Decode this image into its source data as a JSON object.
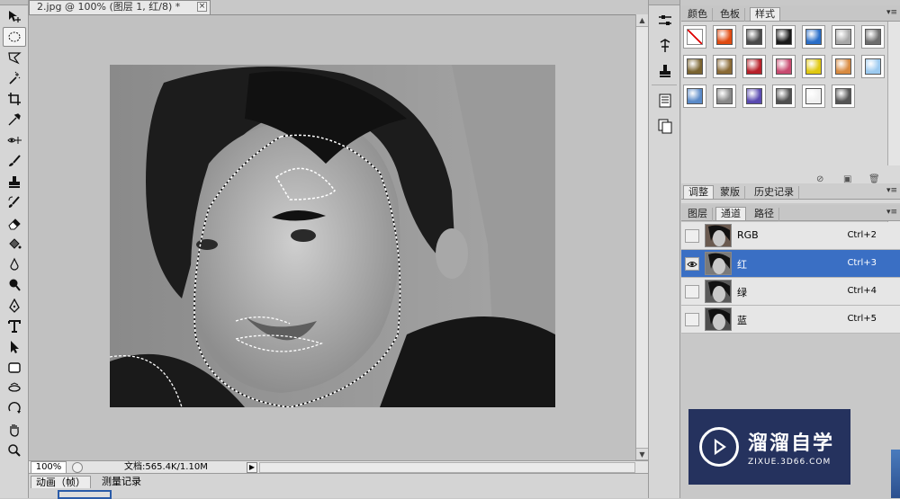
{
  "document": {
    "tab_title": "2.jpg @ 100% (图层 1, 红/8) *",
    "close_glyph": "×"
  },
  "status": {
    "zoom": "100%",
    "doc_size": "文档:565.4K/1.10M",
    "play_glyph": "▶"
  },
  "bottom_panel": {
    "tabs": [
      "动画（帧）",
      "测量记录"
    ]
  },
  "styles_panel": {
    "tabs": [
      "颜色",
      "色板",
      "样式"
    ],
    "active_tab": "样式",
    "swatches": [
      {
        "name": "none",
        "color": "#ffffff"
      },
      {
        "name": "red-glow",
        "color": "#e04a10"
      },
      {
        "name": "dark-gray",
        "color": "#4a4a4a"
      },
      {
        "name": "black-glossy",
        "color": "#1a1a1a"
      },
      {
        "name": "blue-glossy",
        "color": "#2a6ec8"
      },
      {
        "name": "light-gray",
        "color": "#a8a8a8"
      },
      {
        "name": "gradient-gray",
        "color": "#6e6e6e"
      },
      {
        "name": "olive-brown",
        "color": "#7a6430"
      },
      {
        "name": "brown-gradient",
        "color": "#8a6a35"
      },
      {
        "name": "red-pattern",
        "color": "#b8202a"
      },
      {
        "name": "multicolor",
        "color": "#c84a70"
      },
      {
        "name": "yellow-pattern",
        "color": "#e0c810"
      },
      {
        "name": "orange-tan",
        "color": "#d88a40"
      },
      {
        "name": "light-blue",
        "color": "#9ccaf0"
      },
      {
        "name": "sky-landscape",
        "color": "#5a8ac8"
      },
      {
        "name": "gray-pattern",
        "color": "#888888"
      },
      {
        "name": "purple-blue",
        "color": "#5a4ab0"
      },
      {
        "name": "charcoal",
        "color": "#505050"
      },
      {
        "name": "outline-white",
        "color": "#f0f0f0"
      },
      {
        "name": "dark-gray-2",
        "color": "#555555"
      }
    ]
  },
  "adjust_panel": {
    "tabs": [
      "调整",
      "蒙版",
      "历史记录"
    ]
  },
  "channels_panel": {
    "tabs": [
      "图层",
      "通道",
      "路径"
    ],
    "active_tab": "通道",
    "channels": [
      {
        "name": "RGB",
        "shortcut": "Ctrl+2",
        "visible": false,
        "selected": false
      },
      {
        "name": "红",
        "shortcut": "Ctrl+3",
        "visible": true,
        "selected": true
      },
      {
        "name": "绿",
        "shortcut": "Ctrl+4",
        "visible": false,
        "selected": false
      },
      {
        "name": "蓝",
        "shortcut": "Ctrl+5",
        "visible": false,
        "selected": false
      }
    ]
  },
  "watermark": {
    "title": "溜溜自学",
    "url": "ZIXUE.3D66.COM"
  },
  "icons": {
    "tools": [
      "move-icon",
      "marquee-icon",
      "lasso-icon",
      "magic-wand-icon",
      "crop-icon",
      "eyedropper-icon",
      "spot-heal-icon",
      "brush-icon",
      "clone-stamp-icon",
      "history-brush-icon",
      "eraser-icon",
      "paint-bucket-icon",
      "blur-icon",
      "dodge-icon",
      "pen-icon",
      "type-icon",
      "path-select-icon",
      "shape-icon",
      "3d-rotate-icon",
      "3d-orbit-icon",
      "hand-icon",
      "zoom-icon"
    ],
    "dock": [
      "adjust-levels-icon",
      "3d-tools-icon",
      "stamp-icon",
      "layers-doc-icon",
      "copy-doc-icon"
    ]
  }
}
